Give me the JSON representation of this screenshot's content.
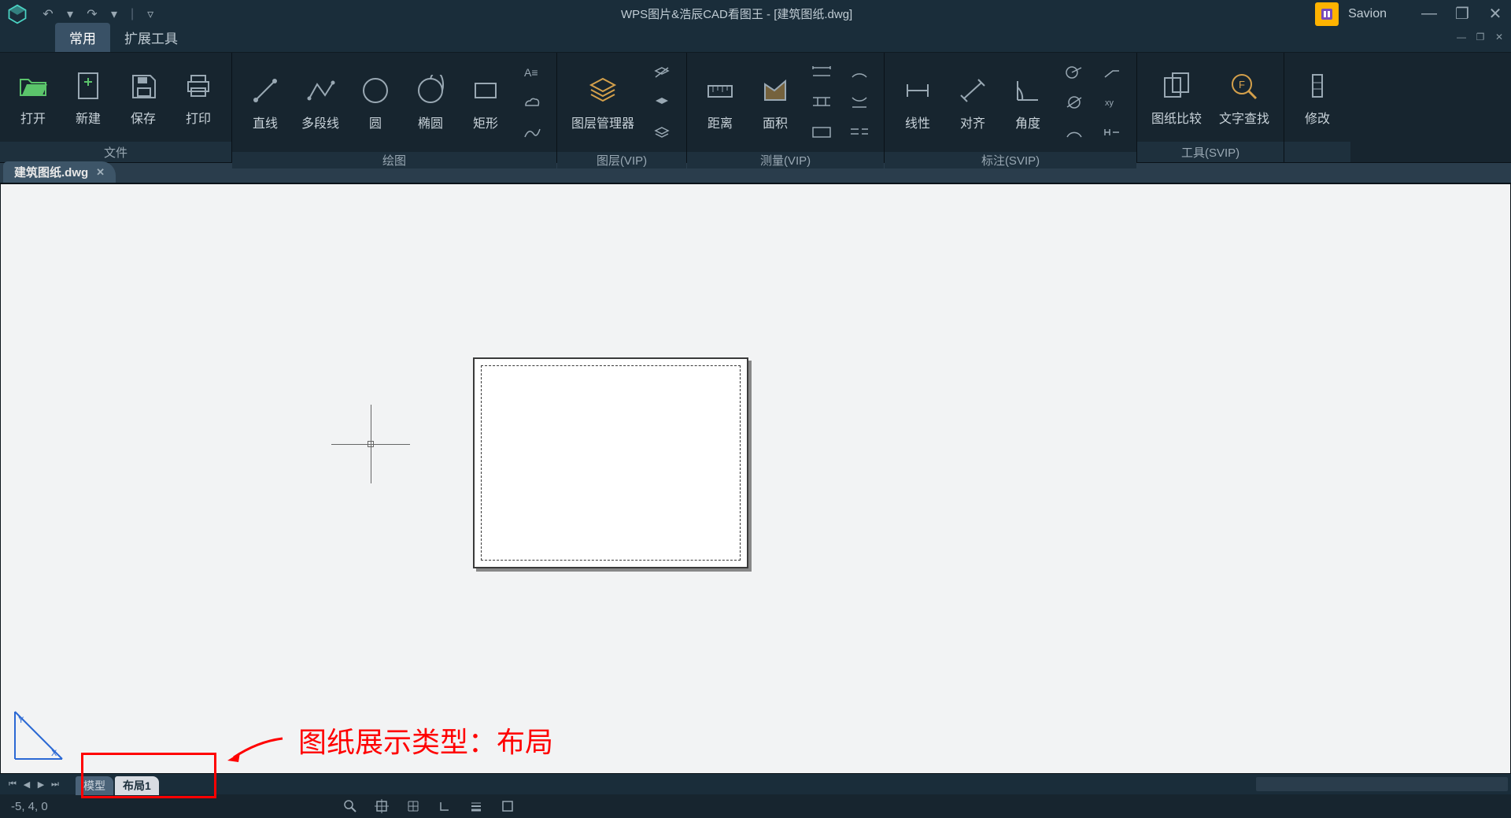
{
  "titlebar": {
    "title": "WPS图片&浩辰CAD看图王 - [建筑图纸.dwg]",
    "user": "Savion"
  },
  "tabs": {
    "active": "常用",
    "ext": "扩展工具"
  },
  "ribbon": {
    "file": {
      "title": "文件",
      "open": "打开",
      "new": "新建",
      "save": "保存",
      "print": "打印"
    },
    "draw": {
      "title": "绘图",
      "line": "直线",
      "polyline": "多段线",
      "circle": "圆",
      "ellipse": "椭圆",
      "rect": "矩形"
    },
    "layer": {
      "title": "图层(VIP)",
      "mgr": "图层管理器"
    },
    "measure": {
      "title": "测量(VIP)",
      "dist": "距离",
      "area": "面积"
    },
    "annotate": {
      "title": "标注(SVIP)",
      "linear": "线性",
      "align": "对齐",
      "angle": "角度"
    },
    "tools": {
      "title": "工具(SVIP)",
      "compare": "图纸比较",
      "findtext": "文字查找"
    },
    "modify": {
      "title": "",
      "btn": "修改"
    }
  },
  "doc": {
    "name": "建筑图纸.dwg"
  },
  "layout": {
    "model": "模型",
    "layout1": "布局1"
  },
  "annotation": "图纸展示类型：布局",
  "status": {
    "coords": "-5, 4, 0"
  }
}
